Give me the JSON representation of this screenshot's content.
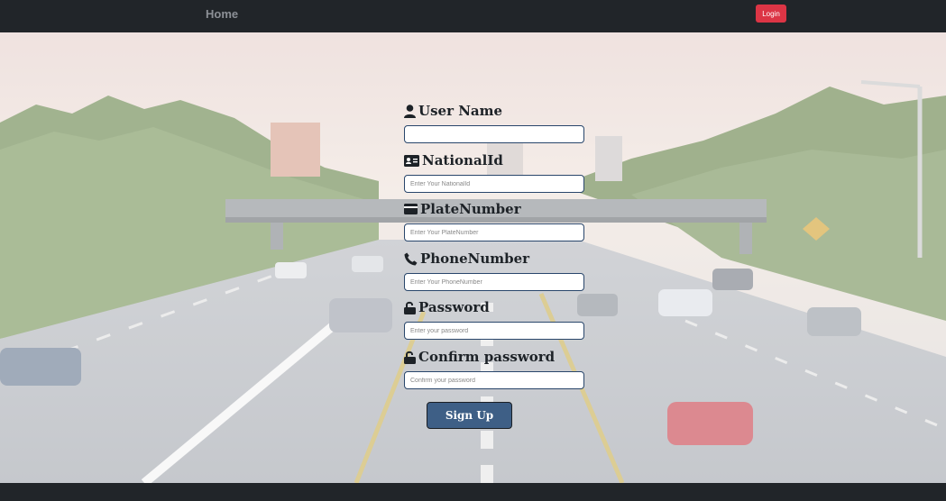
{
  "navbar": {
    "home_label": "Home",
    "login_label": "Login",
    "login_color": "#dc3545"
  },
  "form": {
    "fields": [
      {
        "label": "User Name",
        "icon": "user-icon",
        "value": "",
        "placeholder": ""
      },
      {
        "label": "NationalId",
        "icon": "id-card-icon",
        "value": "",
        "placeholder": "Enter Your NationalId"
      },
      {
        "label": "PlateNumber",
        "icon": "credit-card-icon",
        "value": "",
        "placeholder": "Enter Your PlateNumber"
      },
      {
        "label": "PhoneNumber",
        "icon": "phone-icon",
        "value": "",
        "placeholder": "Enter Your PhoneNumber"
      },
      {
        "label": "Password",
        "icon": "lock-open-icon",
        "value": "",
        "placeholder": "Enter your password"
      },
      {
        "label": "Confirm password",
        "icon": "lock-open-icon",
        "value": "",
        "placeholder": "Confirm your password"
      }
    ],
    "submit_label": "Sign Up"
  },
  "colors": {
    "navbar": "#212529",
    "accent": "#3e5f86",
    "input_border": "#29466b"
  }
}
